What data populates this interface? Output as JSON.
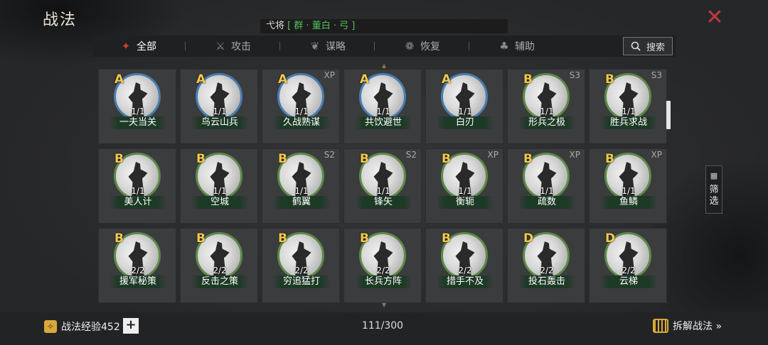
{
  "header": {
    "title": "战法",
    "general_prefix": "c将",
    "general_prefix_text": "弋将",
    "general_value": "[ 群 · 董白 · 弓 ]",
    "close_label": "✕"
  },
  "tabs": [
    {
      "label": "全部",
      "icon": "scroll-icon",
      "glyph": "✦"
    },
    {
      "label": "攻击",
      "icon": "swords-icon",
      "glyph": "⚔"
    },
    {
      "label": "谋略",
      "icon": "fan-icon",
      "glyph": "❦"
    },
    {
      "label": "恢复",
      "icon": "cup-icon",
      "glyph": "❁"
    },
    {
      "label": "辅助",
      "icon": "bag-icon",
      "glyph": "♣"
    }
  ],
  "search": {
    "label": "搜索",
    "icon": "search-icon"
  },
  "filter": {
    "label_1": "筛",
    "label_2": "选",
    "icon": "grid-icon"
  },
  "skills": [
    {
      "grade": "A",
      "tag": "",
      "count": "1/1",
      "name": "一夫当关",
      "ring": "blue"
    },
    {
      "grade": "A",
      "tag": "",
      "count": "1/1",
      "name": "鸟云山兵",
      "ring": "blue"
    },
    {
      "grade": "A",
      "tag": "XP",
      "count": "1/1",
      "name": "久战熟谋",
      "ring": "blue"
    },
    {
      "grade": "A",
      "tag": "",
      "count": "1/1",
      "name": "共饮避世",
      "ring": "blue"
    },
    {
      "grade": "A",
      "tag": "",
      "count": "1/1",
      "name": "白刃",
      "ring": "blue"
    },
    {
      "grade": "B",
      "tag": "S3",
      "count": "1/1",
      "name": "形兵之极",
      "ring": "green"
    },
    {
      "grade": "B",
      "tag": "S3",
      "count": "1/1",
      "name": "胜兵求战",
      "ring": "green"
    },
    {
      "grade": "B",
      "tag": "",
      "count": "1/1",
      "name": "美人计",
      "ring": "green"
    },
    {
      "grade": "B",
      "tag": "",
      "count": "1/1",
      "name": "空城",
      "ring": "green"
    },
    {
      "grade": "B",
      "tag": "S2",
      "count": "1/1",
      "name": "鹤翼",
      "ring": "green"
    },
    {
      "grade": "B",
      "tag": "S2",
      "count": "1/1",
      "name": "锋矢",
      "ring": "green"
    },
    {
      "grade": "B",
      "tag": "XP",
      "count": "1/1",
      "name": "衡轭",
      "ring": "green"
    },
    {
      "grade": "B",
      "tag": "XP",
      "count": "1/1",
      "name": "疏数",
      "ring": "green"
    },
    {
      "grade": "B",
      "tag": "XP",
      "count": "1/1",
      "name": "鱼鳞",
      "ring": "green"
    },
    {
      "grade": "B",
      "tag": "",
      "count": "2/2",
      "name": "援军秘策",
      "ring": "green"
    },
    {
      "grade": "B",
      "tag": "",
      "count": "2/2",
      "name": "反击之策",
      "ring": "green"
    },
    {
      "grade": "B",
      "tag": "",
      "count": "2/2",
      "name": "穷追猛打",
      "ring": "green"
    },
    {
      "grade": "B",
      "tag": "",
      "count": "2/2",
      "name": "长兵方阵",
      "ring": "green"
    },
    {
      "grade": "B",
      "tag": "",
      "count": "2/2",
      "name": "措手不及",
      "ring": "green"
    },
    {
      "grade": "D",
      "tag": "",
      "count": "2/2",
      "name": "投石轰击",
      "ring": "green"
    },
    {
      "grade": "D",
      "tag": "",
      "count": "2/2",
      "name": "云梯",
      "ring": "green"
    }
  ],
  "footer": {
    "exp_label": "战法经验452",
    "plus_label": "+",
    "page_count": "111/300",
    "decompose_label": "拆解战法 »"
  },
  "colors": {
    "accent_red": "#d23b34",
    "grade_gold": "#f2c74a",
    "ring_blue": "#4a7db0",
    "ring_green": "#5d8a47",
    "highlight_green": "#4fc35a"
  }
}
